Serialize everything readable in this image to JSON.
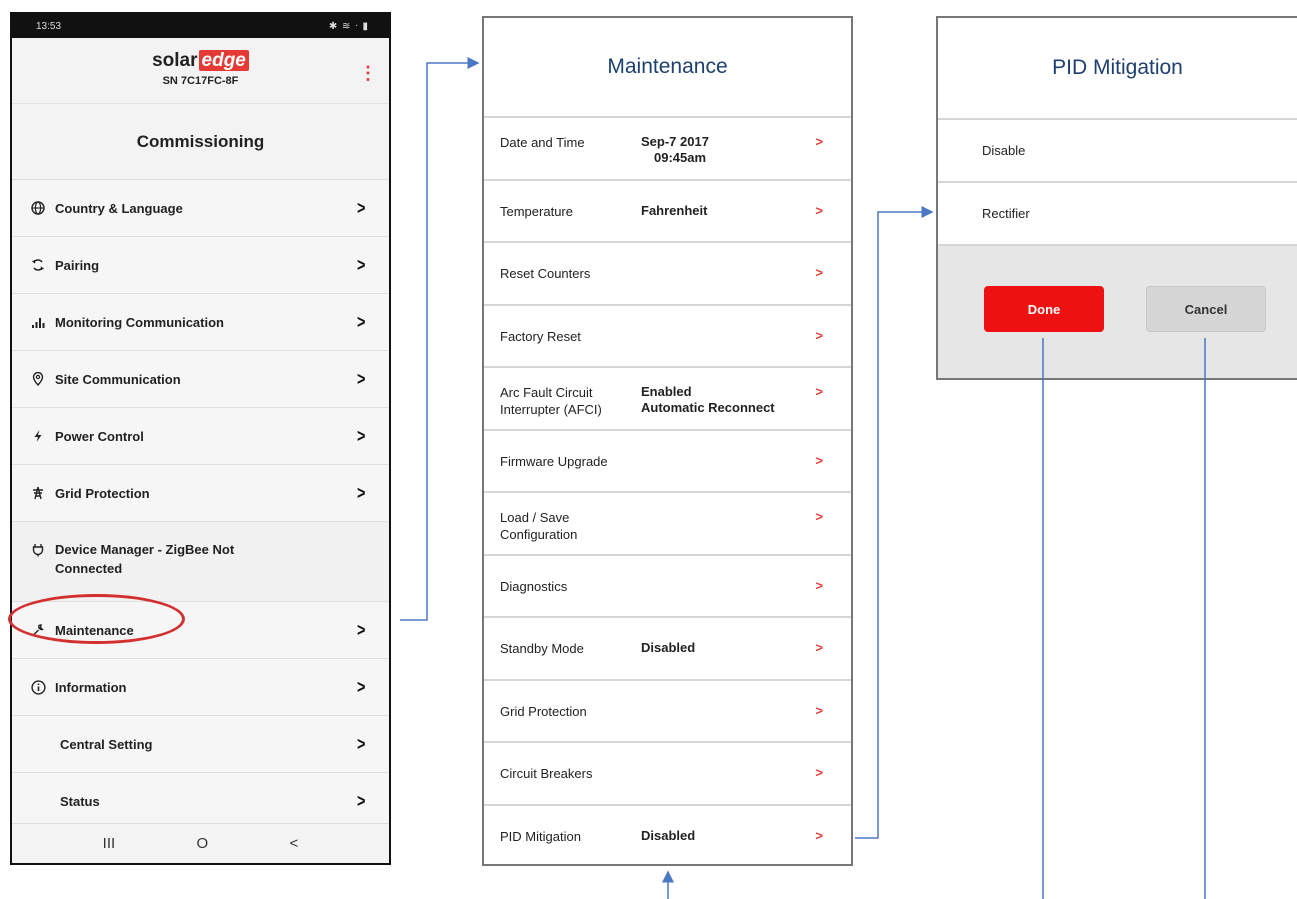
{
  "phone": {
    "time": "13:53",
    "status_icons": "✱ ≋ ᐧ ▮",
    "logo_solar": "solar",
    "logo_edge": "edge",
    "serial": "SN 7C17FC-8F",
    "menu_dots": "⋮",
    "page_title": "Commissioning",
    "chevron": ">",
    "items": [
      {
        "label": "Country & Language",
        "icon": "globe-icon"
      },
      {
        "label": "Pairing",
        "icon": "sync-icon"
      },
      {
        "label": "Monitoring Communication",
        "icon": "signal-bars-icon"
      },
      {
        "label": "Site Communication",
        "icon": "location-pin-icon"
      },
      {
        "label": "Power Control",
        "icon": "lightning-icon"
      },
      {
        "label": "Grid Protection",
        "icon": "power-tower-icon"
      },
      {
        "label": "Device Manager - ZigBee Not Connected",
        "icon": "plug-icon"
      },
      {
        "label": "Maintenance",
        "icon": "wrench-icon"
      },
      {
        "label": "Information",
        "icon": "info-icon"
      },
      {
        "label": "Central Setting"
      },
      {
        "label": "Status"
      }
    ],
    "nav": {
      "recent": "III",
      "home": "O",
      "back": "<"
    },
    "highlight_color": "#d32f2f"
  },
  "maintenance": {
    "title": "Maintenance",
    "arrow": ">",
    "rows": [
      {
        "label": "Date and Time",
        "value": "Sep-7 2017",
        "value2": "09:45am"
      },
      {
        "label": "Temperature",
        "value": "Fahrenheit"
      },
      {
        "label": "Reset Counters"
      },
      {
        "label": "Factory Reset"
      },
      {
        "label": "Arc Fault Circuit",
        "label2": "Interrupter (AFCI)",
        "value": "Enabled",
        "value2": "Automatic Reconnect"
      },
      {
        "label": "Firmware Upgrade"
      },
      {
        "label": "Load / Save",
        "label2": "Configuration"
      },
      {
        "label": "Diagnostics"
      },
      {
        "label": "Standby Mode",
        "value": "Disabled"
      },
      {
        "label": "Grid Protection"
      },
      {
        "label": "Circuit Breakers"
      },
      {
        "label": "PID Mitigation",
        "value": "Disabled"
      }
    ]
  },
  "pid": {
    "title": "PID Mitigation",
    "options": [
      "Disable",
      "Rectifier"
    ],
    "done_label": "Done",
    "cancel_label": "Cancel"
  },
  "colors": {
    "brand_red": "#e53935",
    "title_blue": "#1f3f6f",
    "connector_blue": "#4a78c2",
    "done_red": "#ee1111"
  }
}
